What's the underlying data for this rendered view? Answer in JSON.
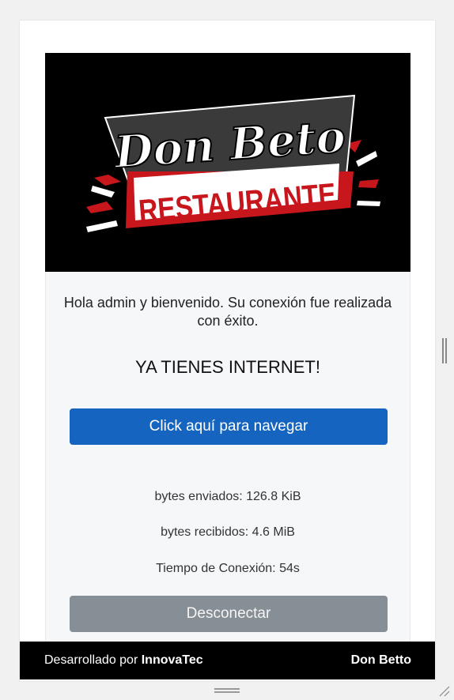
{
  "logo": {
    "line1": "Don Beto",
    "line2": "RESTAURANTE"
  },
  "welcome_text": "Hola admin y bienvenido. Su conexión fue realizada con éxito.",
  "headline": "YA TIENES INTERNET!",
  "browse_button": "Click aquí para navegar",
  "stats": {
    "bytes_sent": "bytes enviados: 126.8 KiB",
    "bytes_received": "bytes recibidos: 4.6 MiB",
    "connection_time": "Tiempo de Conexión: 54s"
  },
  "disconnect_button": "Desconectar",
  "footer": {
    "developed_by_prefix": "Desarrollado por ",
    "developer": "InnovaTec",
    "brand": "Don Betto"
  },
  "colors": {
    "primary": "#1565c0",
    "secondary": "#868e96",
    "logo_red": "#c8161d",
    "footer_bg": "#000000"
  }
}
